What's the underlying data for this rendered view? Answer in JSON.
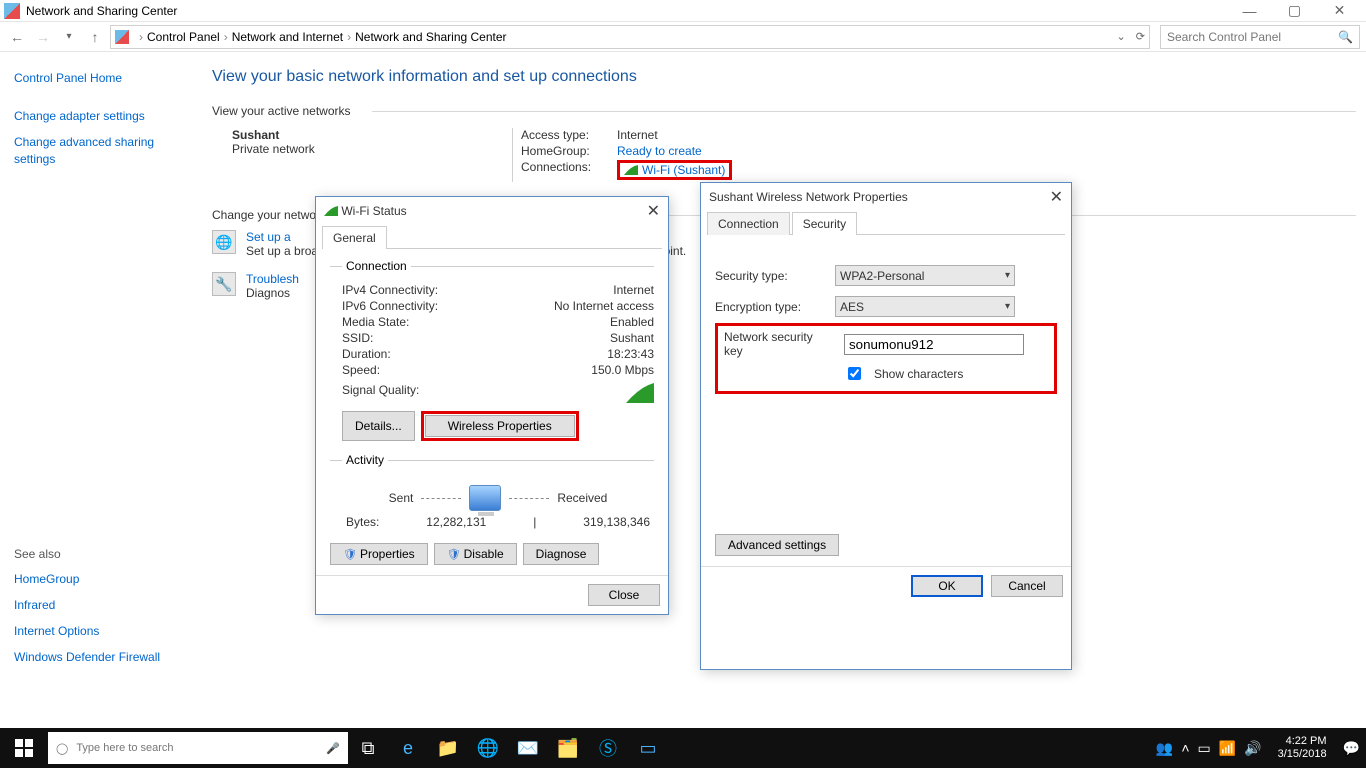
{
  "window": {
    "title": "Network and Sharing Center",
    "breadcrumb": [
      "Control Panel",
      "Network and Internet",
      "Network and Sharing Center"
    ],
    "search_placeholder": "Search Control Panel"
  },
  "sidebar": {
    "home": "Control Panel Home",
    "links": [
      "Change adapter settings",
      "Change advanced sharing settings"
    ],
    "seealso_title": "See also",
    "seealso": [
      "HomeGroup",
      "Infrared",
      "Internet Options",
      "Windows Defender Firewall"
    ]
  },
  "main": {
    "heading": "View your basic network information and set up connections",
    "active_label": "View your active networks",
    "network": {
      "name": "Sushant",
      "type": "Private network",
      "access_k": "Access type:",
      "access_v": "Internet",
      "home_k": "HomeGroup:",
      "home_v": "Ready to create",
      "conn_k": "Connections:",
      "conn_v": "Wi-Fi (Sushant)"
    },
    "change_label": "Change your networking settings",
    "setup": {
      "title": "Set up a",
      "sub": "Set up a broadband, dial-up, or VPN connection; or set up a router or access point."
    },
    "trouble": {
      "title": "Troubleshoot problems",
      "sub": "Diagnose and repair network problems, or get troubleshooting information."
    }
  },
  "wifi_status": {
    "title": "Wi-Fi Status",
    "tab": "General",
    "group1": "Connection",
    "rows": [
      {
        "k": "IPv4 Connectivity:",
        "v": "Internet"
      },
      {
        "k": "IPv6 Connectivity:",
        "v": "No Internet access"
      },
      {
        "k": "Media State:",
        "v": "Enabled"
      },
      {
        "k": "SSID:",
        "v": "Sushant"
      },
      {
        "k": "Duration:",
        "v": "18:23:43"
      },
      {
        "k": "Speed:",
        "v": "150.0 Mbps"
      }
    ],
    "signal": "Signal Quality:",
    "btn_details": "Details...",
    "btn_wprops": "Wireless Properties",
    "group2": "Activity",
    "sent": "Sent",
    "received": "Received",
    "bytes_k": "Bytes:",
    "bytes_sent": "12,282,131",
    "bytes_recv": "319,138,346",
    "btn_props": "Properties",
    "btn_disable": "Disable",
    "btn_diag": "Diagnose",
    "close": "Close"
  },
  "wprops": {
    "title": "Sushant Wireless Network Properties",
    "tab1": "Connection",
    "tab2": "Security",
    "sectype_k": "Security type:",
    "sectype_v": "WPA2-Personal",
    "enc_k": "Encryption type:",
    "enc_v": "AES",
    "key_k": "Network security key",
    "key_v": "sonumonu912",
    "show": "Show characters",
    "adv": "Advanced settings",
    "ok": "OK",
    "cancel": "Cancel"
  },
  "taskbar": {
    "search": "Type here to search",
    "time": "4:22 PM",
    "date": "3/15/2018"
  }
}
